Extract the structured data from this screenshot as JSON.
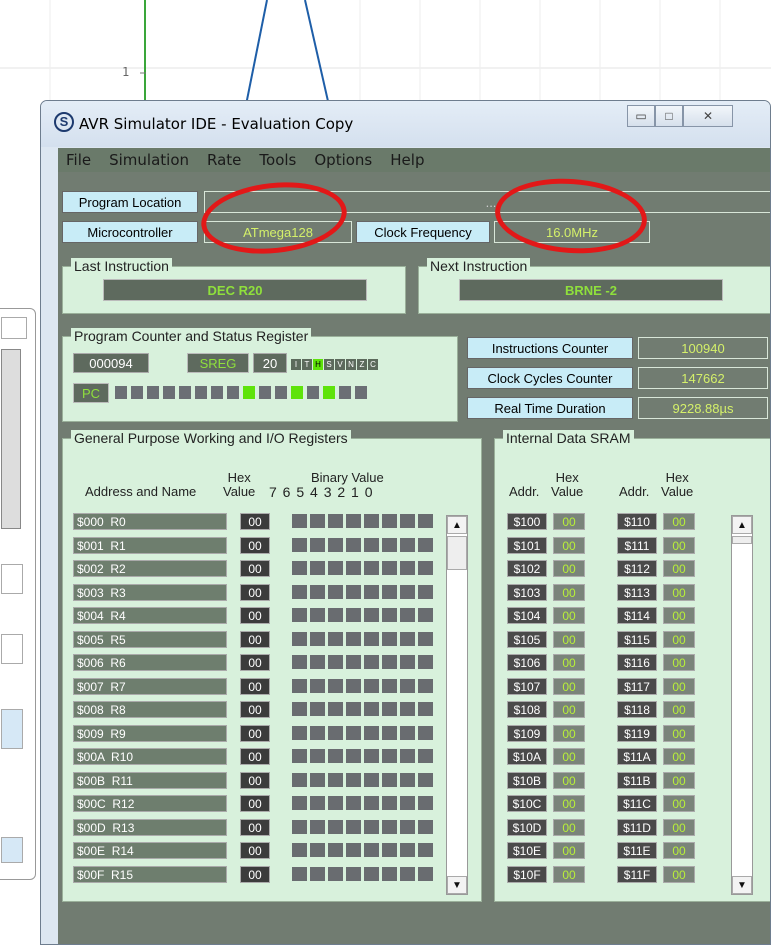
{
  "background": {
    "y_tick_label": "1"
  },
  "window": {
    "title": "AVR Simulator IDE - Evaluation Copy",
    "controls": {
      "minimize": "▭",
      "maximize": "□",
      "close": "✕"
    },
    "menu": [
      "File",
      "Simulation",
      "Rate",
      "Tools",
      "Options",
      "Help"
    ]
  },
  "top": {
    "program_location_label": "Program Location",
    "program_location_value": "...",
    "microcontroller_label": "Microcontroller",
    "microcontroller_value": "ATmega128",
    "clock_label": "Clock Frequency",
    "clock_value": "16.0MHz"
  },
  "last_instruction": {
    "title": "Last Instruction",
    "value": "DEC R20"
  },
  "next_instruction": {
    "title": "Next Instruction",
    "value": "BRNE -2"
  },
  "pc_status": {
    "title": "Program Counter and Status Register",
    "pc_value": "000094",
    "sreg_label": "SREG",
    "sreg_value": "20",
    "flags": [
      "I",
      "T",
      "H",
      "S",
      "V",
      "N",
      "Z",
      "C"
    ],
    "flags_on": [
      false,
      false,
      true,
      false,
      false,
      false,
      false,
      false
    ],
    "pc_label": "PC",
    "pc_bits_on": [
      false,
      false,
      false,
      false,
      false,
      false,
      false,
      false,
      true,
      false,
      false,
      true,
      false,
      true,
      false,
      false
    ]
  },
  "counters": [
    {
      "label": "Instructions Counter",
      "value": "100940"
    },
    {
      "label": "Clock Cycles Counter",
      "value": "147662"
    },
    {
      "label": "Real Time Duration",
      "value": "9228.88µs"
    }
  ],
  "gpr": {
    "title": "General Purpose Working and I/O Registers",
    "col_address": "Address and Name",
    "col_hex": "Hex\nValue",
    "col_binary": "Binary Value",
    "col_bits": "7 6 5 4 3 2 1 0",
    "rows": [
      {
        "name": "$000  R0",
        "hex": "00"
      },
      {
        "name": "$001  R1",
        "hex": "00"
      },
      {
        "name": "$002  R2",
        "hex": "00"
      },
      {
        "name": "$003  R3",
        "hex": "00"
      },
      {
        "name": "$004  R4",
        "hex": "00"
      },
      {
        "name": "$005  R5",
        "hex": "00"
      },
      {
        "name": "$006  R6",
        "hex": "00"
      },
      {
        "name": "$007  R7",
        "hex": "00"
      },
      {
        "name": "$008  R8",
        "hex": "00"
      },
      {
        "name": "$009  R9",
        "hex": "00"
      },
      {
        "name": "$00A  R10",
        "hex": "00"
      },
      {
        "name": "$00B  R11",
        "hex": "00"
      },
      {
        "name": "$00C  R12",
        "hex": "00"
      },
      {
        "name": "$00D  R13",
        "hex": "00"
      },
      {
        "name": "$00E  R14",
        "hex": "00"
      },
      {
        "name": "$00F  R15",
        "hex": "00"
      }
    ]
  },
  "sram": {
    "title": "Internal Data SRAM",
    "col_addr": "Addr.",
    "col_hex": "Hex\nValue",
    "left": [
      {
        "addr": "$100",
        "val": "00"
      },
      {
        "addr": "$101",
        "val": "00"
      },
      {
        "addr": "$102",
        "val": "00"
      },
      {
        "addr": "$103",
        "val": "00"
      },
      {
        "addr": "$104",
        "val": "00"
      },
      {
        "addr": "$105",
        "val": "00"
      },
      {
        "addr": "$106",
        "val": "00"
      },
      {
        "addr": "$107",
        "val": "00"
      },
      {
        "addr": "$108",
        "val": "00"
      },
      {
        "addr": "$109",
        "val": "00"
      },
      {
        "addr": "$10A",
        "val": "00"
      },
      {
        "addr": "$10B",
        "val": "00"
      },
      {
        "addr": "$10C",
        "val": "00"
      },
      {
        "addr": "$10D",
        "val": "00"
      },
      {
        "addr": "$10E",
        "val": "00"
      },
      {
        "addr": "$10F",
        "val": "00"
      }
    ],
    "right": [
      {
        "addr": "$110",
        "val": "00"
      },
      {
        "addr": "$111",
        "val": "00"
      },
      {
        "addr": "$112",
        "val": "00"
      },
      {
        "addr": "$113",
        "val": "00"
      },
      {
        "addr": "$114",
        "val": "00"
      },
      {
        "addr": "$115",
        "val": "00"
      },
      {
        "addr": "$116",
        "val": "00"
      },
      {
        "addr": "$117",
        "val": "00"
      },
      {
        "addr": "$118",
        "val": "00"
      },
      {
        "addr": "$119",
        "val": "00"
      },
      {
        "addr": "$11A",
        "val": "00"
      },
      {
        "addr": "$11B",
        "val": "00"
      },
      {
        "addr": "$11C",
        "val": "00"
      },
      {
        "addr": "$11D",
        "val": "00"
      },
      {
        "addr": "$11E",
        "val": "00"
      },
      {
        "addr": "$11F",
        "val": "00"
      }
    ]
  },
  "colors": {
    "annotation": "#e21818",
    "value_text": "#d4f06a",
    "label_bg": "#c8ecf7",
    "panel_bg": "#d8f1dc"
  }
}
